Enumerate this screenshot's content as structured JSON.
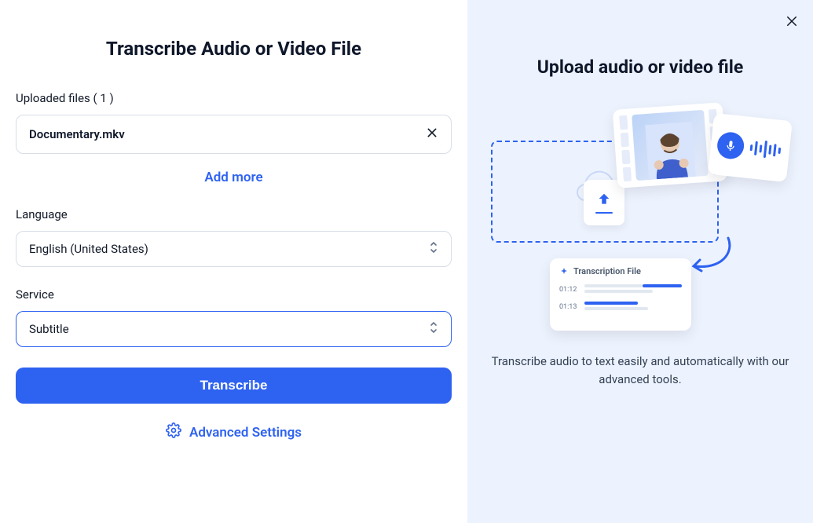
{
  "left": {
    "title": "Transcribe Audio or Video File",
    "uploaded_label": "Uploaded files ( 1 )",
    "file_name": "Documentary.mkv",
    "add_more": "Add more",
    "language_label": "Language",
    "language_value": "English (United States)",
    "service_label": "Service",
    "service_value": "Subtitle",
    "transcribe_button": "Transcribe",
    "advanced_settings": "Advanced Settings"
  },
  "right": {
    "title": "Upload audio or video file",
    "description": "Transcribe audio to text easily and automatically with our advanced tools.",
    "transcript_card_title": "Transcription File",
    "timestamp1": "01:12",
    "timestamp2": "01:13"
  },
  "colors": {
    "accent": "#2e62f1",
    "panel_bg": "#edf3fe",
    "border": "#d8dde6"
  }
}
